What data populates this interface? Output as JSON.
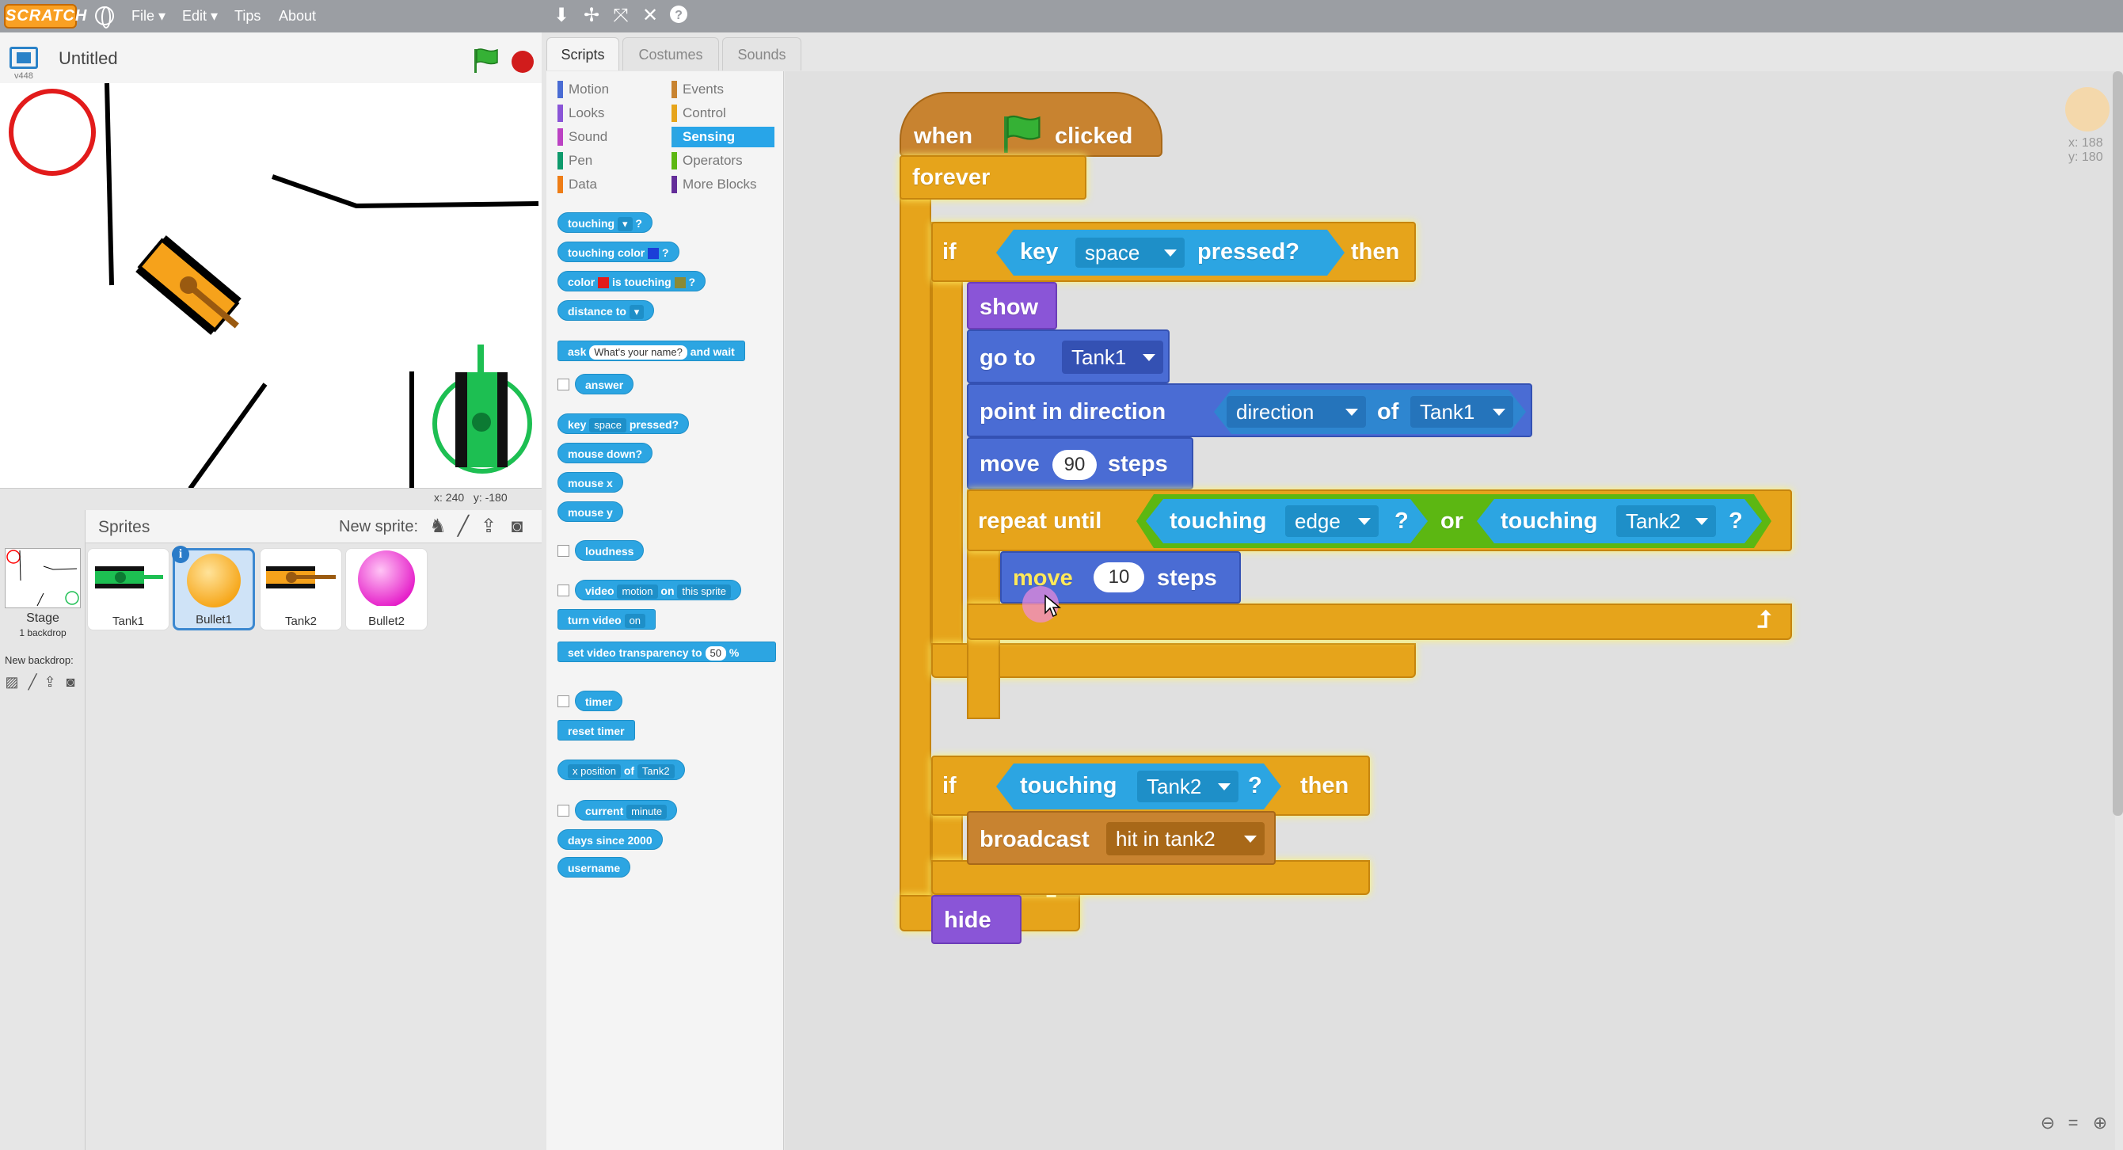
{
  "menu": {
    "logo": "SCRATCH",
    "items": [
      {
        "label": "File ▾"
      },
      {
        "label": "Edit ▾"
      },
      {
        "label": "Tips"
      },
      {
        "label": "About"
      }
    ],
    "tool_icons": [
      "duplicate-icon",
      "cut-icon",
      "grow-icon",
      "shrink-icon",
      "help-icon"
    ]
  },
  "stage": {
    "version": "v448",
    "project_title": "Untitled",
    "coords_x": "x: 240",
    "coords_y": "y: -180"
  },
  "sprites": {
    "header": "Sprites",
    "new_sprite_label": "New sprite:",
    "items": [
      {
        "name": "Tank1"
      },
      {
        "name": "Bullet1"
      },
      {
        "name": "Tank2"
      },
      {
        "name": "Bullet2"
      }
    ],
    "stage_label": "Stage",
    "backdrop_count": "1 backdrop",
    "new_backdrop_label": "New backdrop:"
  },
  "tabs": [
    {
      "label": "Scripts"
    },
    {
      "label": "Costumes"
    },
    {
      "label": "Sounds"
    }
  ],
  "categories": {
    "left": [
      {
        "label": "Motion",
        "color": "#4a6cd4"
      },
      {
        "label": "Looks",
        "color": "#8a55d7"
      },
      {
        "label": "Sound",
        "color": "#bb42c3"
      },
      {
        "label": "Pen",
        "color": "#0e9a6c"
      },
      {
        "label": "Data",
        "color": "#ee7d16"
      }
    ],
    "right": [
      {
        "label": "Events",
        "color": "#c88330"
      },
      {
        "label": "Control",
        "color": "#e6a41b"
      },
      {
        "label": "Sensing",
        "color": "#2ca5e2"
      },
      {
        "label": "Operators",
        "color": "#5cb712"
      },
      {
        "label": "More Blocks",
        "color": "#632d99"
      }
    ],
    "active": "Sensing"
  },
  "palette": {
    "touching": "touching",
    "touching_color": "touching color",
    "color": "color",
    "is_touching": "is touching",
    "distance_to": "distance to",
    "ask": "ask",
    "ask_default": "What's your name?",
    "and_wait": "and wait",
    "answer": "answer",
    "key": "key",
    "key_default": "space",
    "pressed": "pressed?",
    "mouse_down": "mouse down?",
    "mouse_x": "mouse x",
    "mouse_y": "mouse y",
    "loudness": "loudness",
    "video": "video",
    "video_attr": "motion",
    "on": "on",
    "this_sprite": "this sprite",
    "turn_video": "turn video",
    "turn_video_state": "on",
    "set_video_transparency": "set video transparency to",
    "transparency_value": "50",
    "percent": "%",
    "timer": "timer",
    "reset_timer": "reset timer",
    "x_position": "x position",
    "of": "of",
    "of_target": "Tank2",
    "current": "current",
    "current_unit": "minute",
    "days_since_2000": "days since 2000",
    "username": "username",
    "q": "?"
  },
  "script": {
    "when": "when",
    "clicked": "clicked",
    "forever": "forever",
    "if1": "if",
    "key": "key",
    "key_value": "space",
    "pressed": "pressed?",
    "then1": "then",
    "show": "show",
    "go_to": "go to",
    "go_to_target": "Tank1",
    "point_in_direction": "point in direction",
    "direction_attr": "direction",
    "of": "of",
    "direction_target": "Tank1",
    "move1": "move",
    "move1_steps": "90",
    "steps1": "steps",
    "repeat_until": "repeat until",
    "touching1": "touching",
    "touching1_target": "edge",
    "q1": "?",
    "or": "or",
    "touching2": "touching",
    "touching2_target": "Tank2",
    "q2": "?",
    "move2": "move",
    "move2_steps": "10",
    "steps2": "steps",
    "if2": "if",
    "touching3": "touching",
    "touching3_target": "Tank2",
    "q3": "?",
    "then2": "then",
    "broadcast": "broadcast",
    "broadcast_message": "hit in tank2",
    "hide": "hide"
  },
  "sprite_info": {
    "x": "x: 188",
    "y": "y: 180"
  },
  "colors": {
    "control": "#e6a41b",
    "motion": "#4a6cd4",
    "looks": "#8a55d7",
    "events": "#c88330",
    "sensing": "#2ca5e2",
    "operators": "#5cb712"
  }
}
